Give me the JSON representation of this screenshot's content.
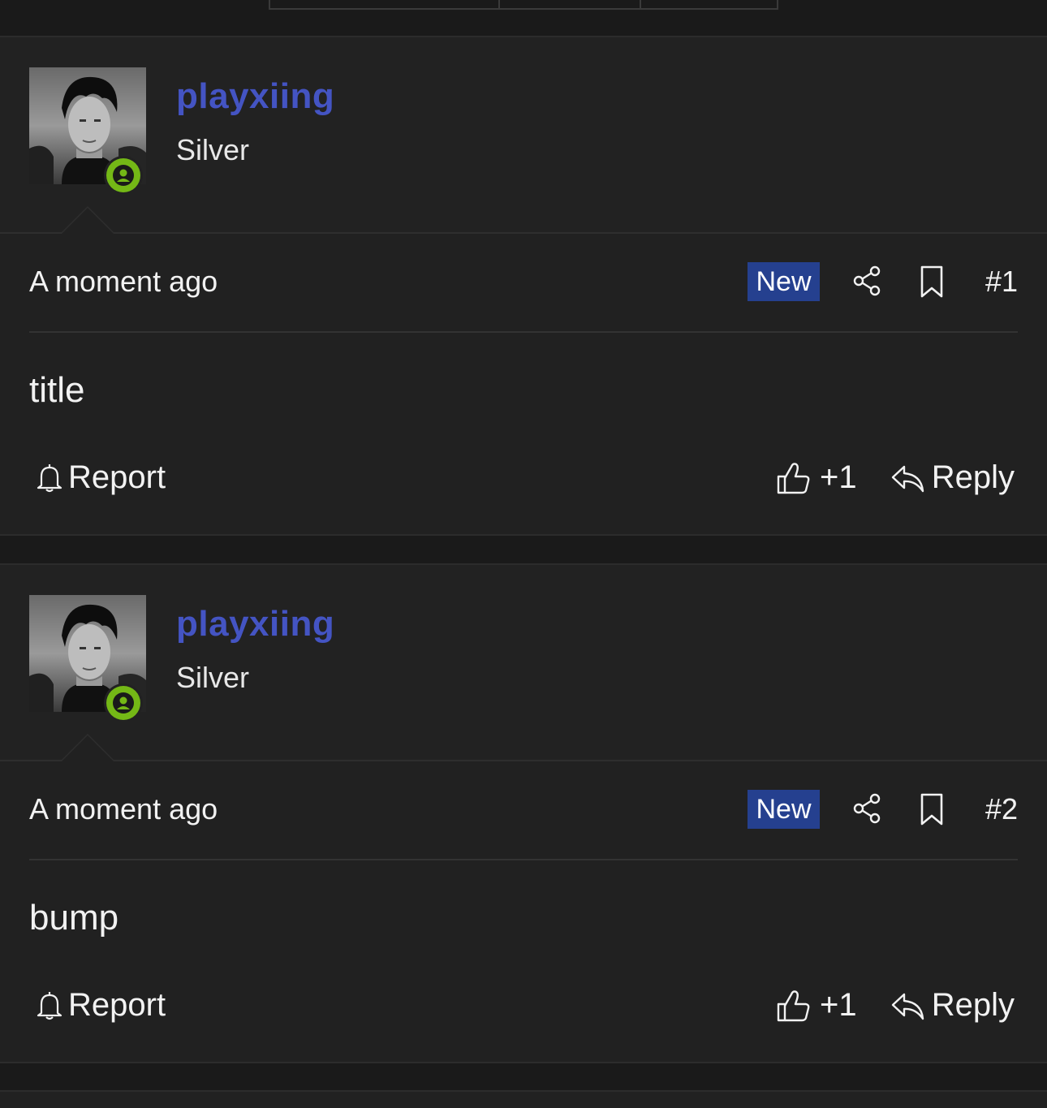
{
  "posts": [
    {
      "username": "playxiing",
      "rank": "Silver",
      "timestamp": "A moment ago",
      "badge": "New",
      "number": "#1",
      "content": "title",
      "report_label": "Report",
      "like_label": "+1",
      "reply_label": "Reply"
    },
    {
      "username": "playxiing",
      "rank": "Silver",
      "timestamp": "A moment ago",
      "badge": "New",
      "number": "#2",
      "content": "bump",
      "report_label": "Report",
      "like_label": "+1",
      "reply_label": "Reply"
    }
  ],
  "colors": {
    "background": "#1a1a1a",
    "post_background": "#212121",
    "username": "#4454c3",
    "new_badge": "#25408f",
    "online": "#74b816"
  },
  "icons": {
    "online": "user-online-icon",
    "share": "share-icon",
    "bookmark": "bookmark-icon",
    "report": "bell-icon",
    "like": "thumbs-up-icon",
    "reply": "reply-icon"
  }
}
